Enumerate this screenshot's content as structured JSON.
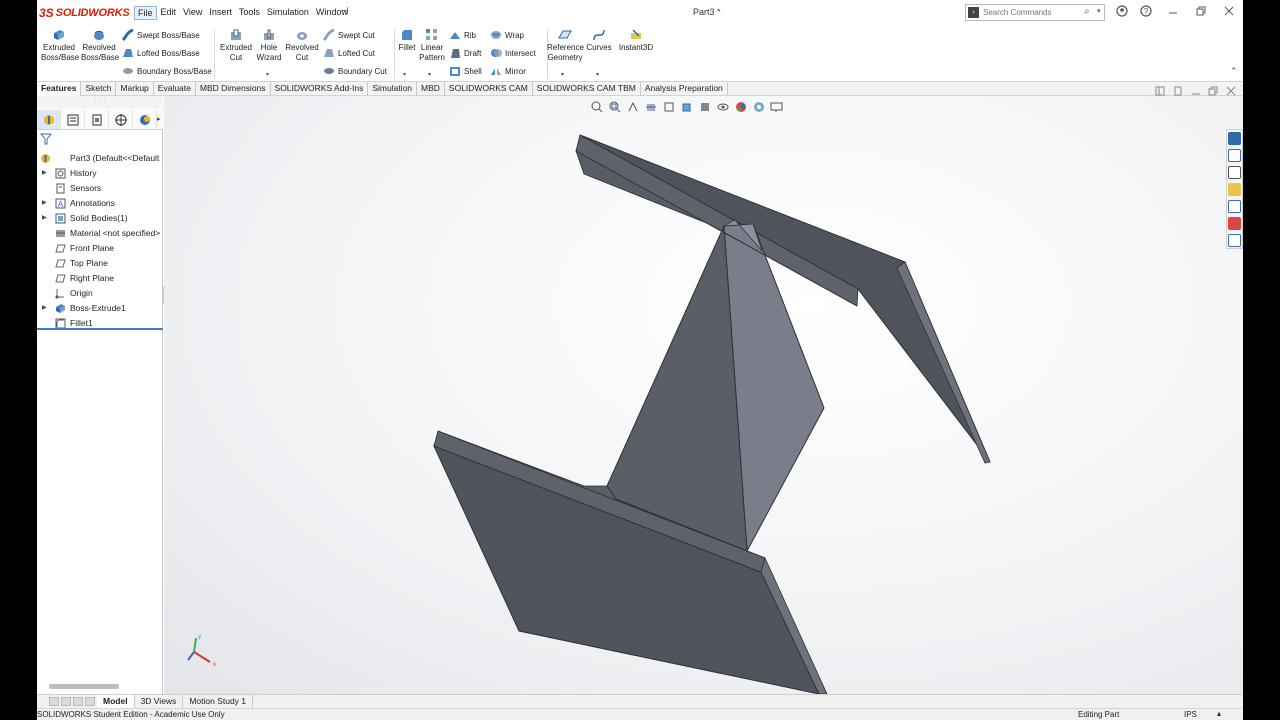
{
  "app": {
    "logo": {
      "mark": "3S",
      "name": "SOLIDWORKS"
    },
    "document_title": "Part3 *"
  },
  "menu": [
    "File",
    "Edit",
    "View",
    "Insert",
    "Tools",
    "Simulation",
    "Window"
  ],
  "search": {
    "placeholder": "Search Commands"
  },
  "ribbon": {
    "extruded_boss": [
      "Extruded",
      "Boss/Base"
    ],
    "revolved_boss": [
      "Revolved",
      "Boss/Base"
    ],
    "swept_boss": "Swept Boss/Base",
    "lofted_boss": "Lofted Boss/Base",
    "boundary_boss": "Boundary Boss/Base",
    "extruded_cut": [
      "Extruded",
      "Cut"
    ],
    "hole_wizard": [
      "Hole",
      "Wizard"
    ],
    "revolved_cut": [
      "Revolved",
      "Cut"
    ],
    "swept_cut": "Swept Cut",
    "lofted_cut": "Lofted Cut",
    "boundary_cut": "Boundary Cut",
    "fillet": "Fillet",
    "linear_pattern": [
      "Linear",
      "Pattern"
    ],
    "rib": "Rib",
    "draft": "Draft",
    "shell": "Shell",
    "wrap": "Wrap",
    "intersect": "Intersect",
    "mirror": "Mirror",
    "reference_geometry": [
      "Reference",
      "Geometry"
    ],
    "curves": "Curves",
    "instant3d": "Instant3D"
  },
  "tabs": [
    "Features",
    "Sketch",
    "Markup",
    "Evaluate",
    "MBD Dimensions",
    "SOLIDWORKS Add-Ins",
    "Simulation",
    "MBD",
    "SOLIDWORKS CAM",
    "SOLIDWORKS CAM TBM",
    "Analysis Preparation"
  ],
  "tree": [
    {
      "label": "Part3  (Default<<Default",
      "expander": "",
      "icon": "part-icon"
    },
    {
      "label": "History",
      "expander": "▶",
      "icon": "history-icon"
    },
    {
      "label": "Sensors",
      "expander": "",
      "icon": "sensors-icon"
    },
    {
      "label": "Annotations",
      "expander": "▶",
      "icon": "annotations-icon"
    },
    {
      "label": "Solid Bodies(1)",
      "expander": "▶",
      "icon": "solid-bodies-icon"
    },
    {
      "label": "Material <not specified>",
      "expander": "",
      "icon": "material-icon"
    },
    {
      "label": "Front Plane",
      "expander": "",
      "icon": "plane-icon"
    },
    {
      "label": "Top Plane",
      "expander": "",
      "icon": "plane-icon"
    },
    {
      "label": "Right Plane",
      "expander": "",
      "icon": "plane-icon"
    },
    {
      "label": "Origin",
      "expander": "",
      "icon": "origin-icon"
    },
    {
      "label": "Boss-Extrude1",
      "expander": "▶",
      "icon": "extrude-icon"
    },
    {
      "label": "Fillet1",
      "expander": "",
      "icon": "fillet-icon"
    }
  ],
  "bottom_tabs": [
    "Model",
    "3D Views",
    "Motion Study 1"
  ],
  "status": {
    "edition": "SOLIDWORKS Student Edition - Academic Use Only",
    "mode": "Editing Part",
    "units": "IPS"
  },
  "triad": {
    "x": "x",
    "y": "y"
  },
  "colors": {
    "accent": "#d81e05",
    "selection": "#3a7bd5",
    "model_face_dark": "#4f535b",
    "model_face_web": "#7a7e8a",
    "model_edge": "#2d3036"
  }
}
